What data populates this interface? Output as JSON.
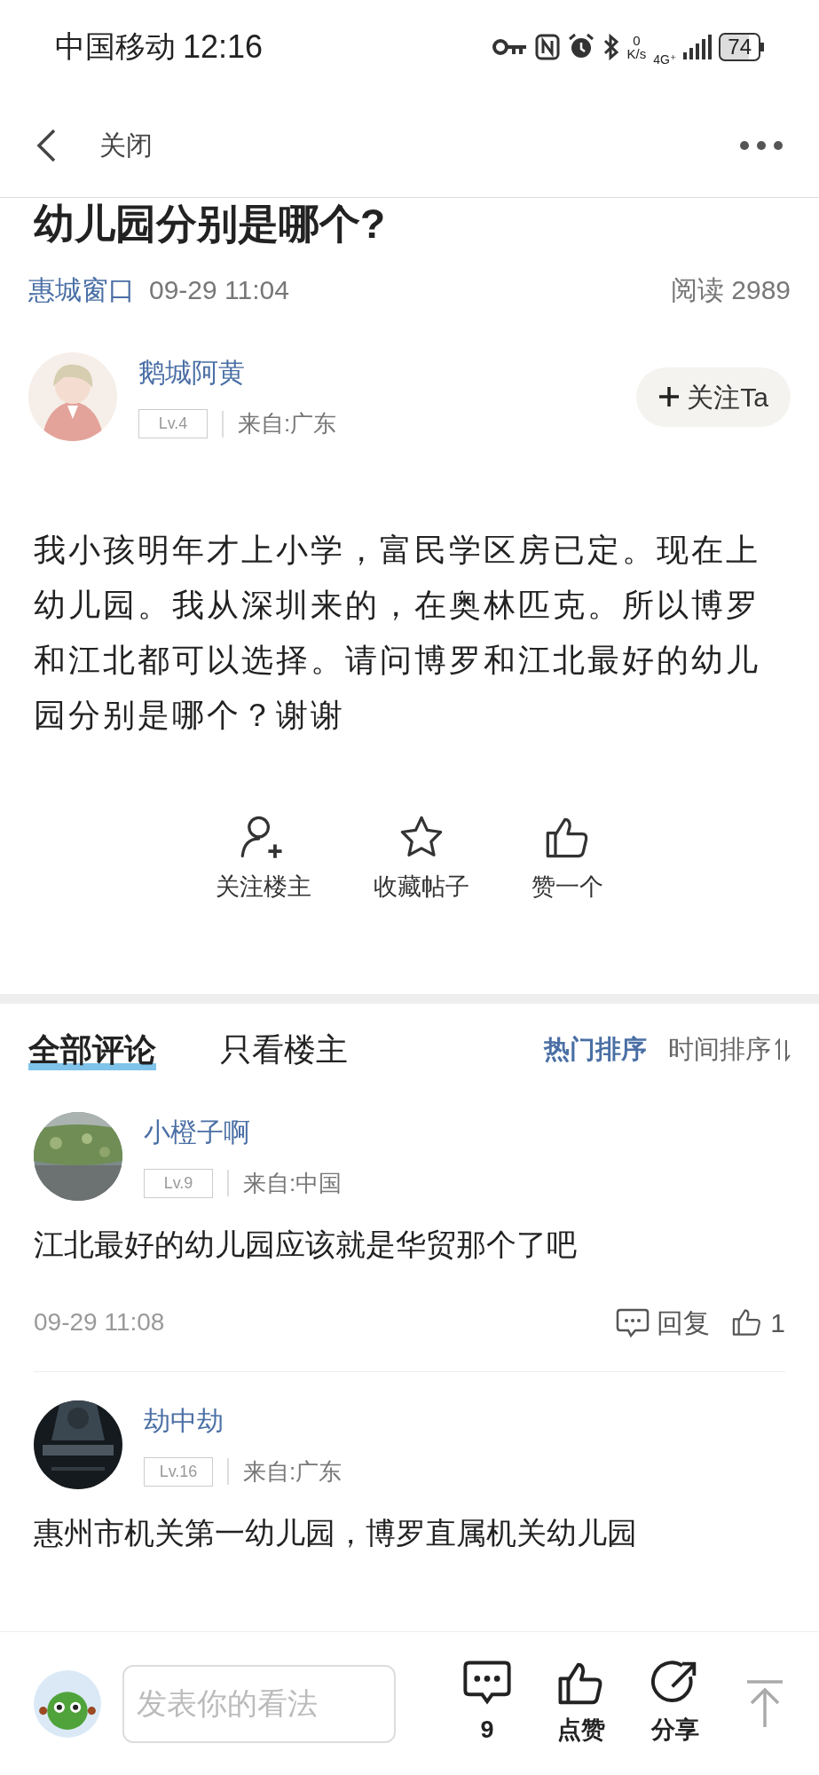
{
  "status_bar": {
    "carrier": "中国移动",
    "time": "12:16",
    "net_speed_value": "0",
    "net_speed_unit": "K/s",
    "network": "4G⁺",
    "battery": "74"
  },
  "header": {
    "close_label": "关闭"
  },
  "post": {
    "title": "幼儿园分别是哪个?",
    "source": "惠城窗口",
    "datetime": "09-29 11:04",
    "views": "阅读 2989",
    "author": {
      "name": "鹅城阿黄",
      "level": "Lv.4",
      "location": "来自:广东",
      "follow_label": "关注Ta"
    },
    "body": "我小孩明年才上小学，富民学区房已定。现在上幼儿园。我从深圳来的，在奥林匹克。所以博罗和江北都可以选择。请问博罗和江北最好的幼儿园分别是哪个？谢谢",
    "actions": [
      {
        "kind": "follow",
        "label": "关注楼主"
      },
      {
        "kind": "favorite",
        "label": "收藏帖子"
      },
      {
        "kind": "like",
        "label": "赞一个"
      }
    ]
  },
  "comment_tabs": [
    {
      "label": "全部评论",
      "selected": true
    },
    {
      "label": "只看楼主",
      "selected": false
    }
  ],
  "sort_options": [
    {
      "label": "热门排序",
      "selected": true
    },
    {
      "label": "时间排序",
      "selected": false
    }
  ],
  "comments": [
    {
      "name": "小橙子啊",
      "level": "Lv.9",
      "location": "来自:中国",
      "text": "江北最好的幼儿园应该就是华贸那个了吧",
      "time": "09-29 11:08",
      "reply_label": "回复",
      "likes": "1"
    },
    {
      "name": "劫中劫",
      "level": "Lv.16",
      "location": "来自:广东",
      "text": "惠州市机关第一幼儿园，博罗直属机关幼儿园"
    }
  ],
  "bottom_bar": {
    "placeholder": "发表你的看法",
    "comment_count": "9",
    "like_label": "点赞",
    "share_label": "分享"
  }
}
